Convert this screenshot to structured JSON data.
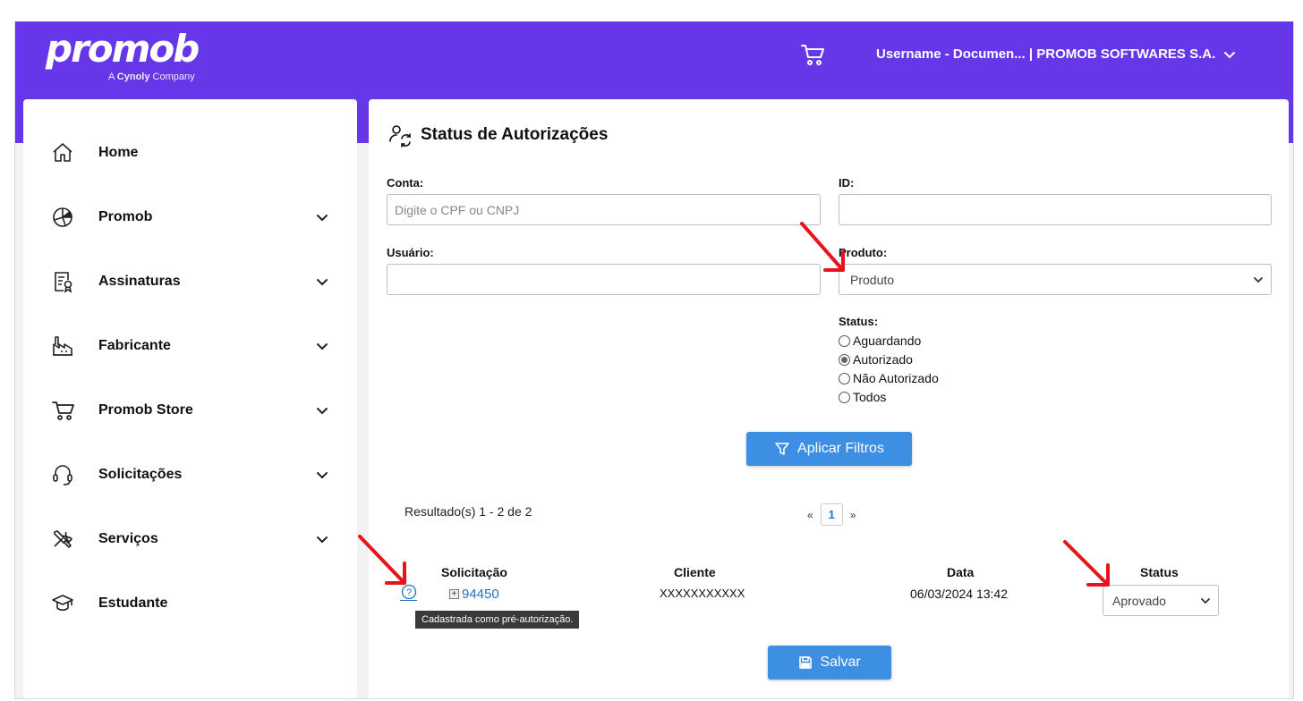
{
  "header": {
    "logo": "promob",
    "logo_sub_prefix": "A",
    "logo_sub_brand": "Cynoly",
    "logo_sub_suffix": "Company",
    "user_label": "Username - Documen... | PROMOB SOFTWARES S.A."
  },
  "sidebar": {
    "items": [
      {
        "label": "Home",
        "icon": "home-icon"
      },
      {
        "label": "Promob",
        "icon": "promob-icon"
      },
      {
        "label": "Assinaturas",
        "icon": "certificate-icon"
      },
      {
        "label": "Fabricante",
        "icon": "factory-icon"
      },
      {
        "label": "Promob Store",
        "icon": "cart-icon"
      },
      {
        "label": "Solicitações",
        "icon": "headset-icon"
      },
      {
        "label": "Serviços",
        "icon": "tools-icon"
      },
      {
        "label": "Estudante",
        "icon": "graduation-cap-icon"
      }
    ]
  },
  "page": {
    "title": "Status de Autorizações",
    "icon": "user-refresh-icon"
  },
  "filters": {
    "conta_label": "Conta:",
    "conta_placeholder": "Digite o CPF ou CNPJ",
    "conta_value": "",
    "id_label": "ID:",
    "id_value": "",
    "usuario_label": "Usuário:",
    "usuario_value": "",
    "produto_label": "Produto:",
    "produto_value": "Produto",
    "status_label": "Status:",
    "status_options": [
      "Aguardando",
      "Autorizado",
      "Não Autorizado",
      "Todos"
    ],
    "status_selected": "Autorizado",
    "apply_label": "Aplicar Filtros"
  },
  "results": {
    "summary": "Resultado(s) 1 - 2 de 2",
    "pager_prev": "«",
    "pager_page": "1",
    "pager_next": "»",
    "columns": [
      "Solicitação",
      "Cliente",
      "Data",
      "Status"
    ],
    "rows": [
      {
        "solicitacao": "94450",
        "cliente": "XXXXXXXXXXX",
        "data": "06/03/2024 13:42",
        "status": "Aprovado"
      }
    ],
    "help_glyph": "?",
    "tooltip": "Cadastrada como pré-autorização.",
    "save_label": "Salvar"
  },
  "colors": {
    "brand": "#6537e8",
    "button": "#3d8fe3",
    "link": "#1e73c9",
    "annotation_arrow": "#e8141b"
  }
}
